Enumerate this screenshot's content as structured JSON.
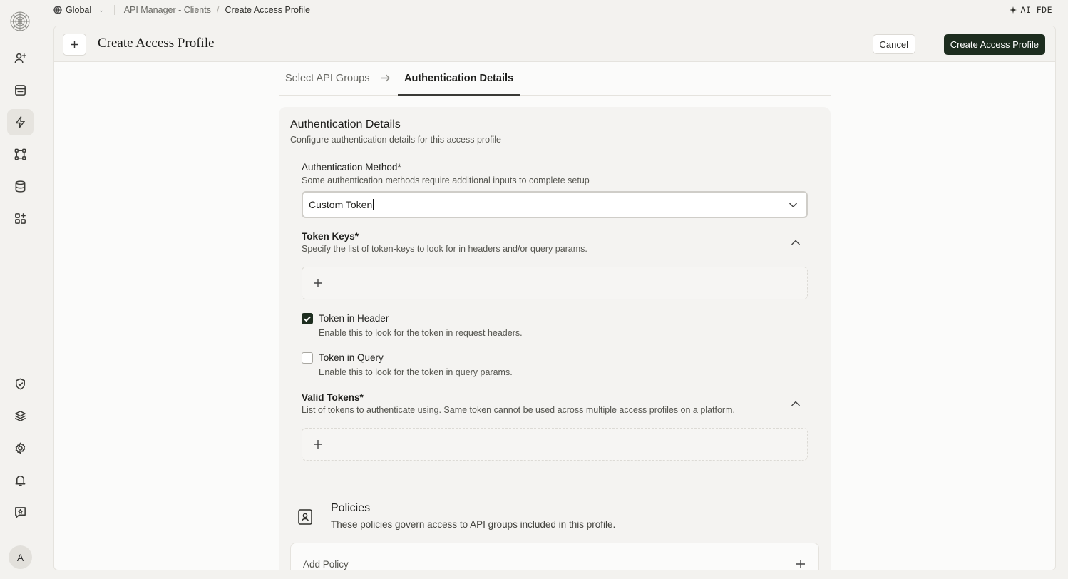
{
  "topbar": {
    "scope": "Global",
    "breadcrumb_parent": "API Manager - Clients",
    "breadcrumb_current": "Create Access Profile",
    "ai_label": "AI FDE"
  },
  "rail": {
    "avatar_initial": "A",
    "icons": [
      "user-add-icon",
      "document-icon",
      "lightning-icon",
      "nodes-icon",
      "database-icon",
      "apps-add-icon",
      "shield-icon",
      "layers-icon",
      "gear-icon",
      "bell-icon",
      "feedback-icon"
    ]
  },
  "header": {
    "title": "Create Access Profile",
    "cancel_label": "Cancel",
    "create_label": "Create Access Profile"
  },
  "steps": {
    "step1": "Select API Groups",
    "step2": "Authentication Details"
  },
  "auth": {
    "title": "Authentication Details",
    "description": "Configure authentication details for this access profile",
    "method_label": "Authentication Method*",
    "method_desc": "Some authentication methods require additional inputs to complete setup",
    "method_value": "Custom Token",
    "token_keys_label": "Token Keys*",
    "token_keys_desc": "Specify the list of token-keys to look for in headers and/or query params.",
    "header_label": "Token in Header",
    "header_desc": "Enable this to look for the token in request headers.",
    "header_checked": true,
    "query_label": "Token in Query",
    "query_desc": "Enable this to look for the token in query params.",
    "query_checked": false,
    "valid_tokens_label": "Valid Tokens*",
    "valid_tokens_desc": "List of tokens to authenticate using. Same token cannot be used across multiple access profiles on a platform."
  },
  "policies": {
    "title": "Policies",
    "description": "These policies govern access to API groups included in this profile.",
    "add_label": "Add Policy"
  },
  "colors": {
    "primary": "#1d2d1f",
    "background": "#f3f2ef",
    "surface": "#fbfbfa"
  }
}
